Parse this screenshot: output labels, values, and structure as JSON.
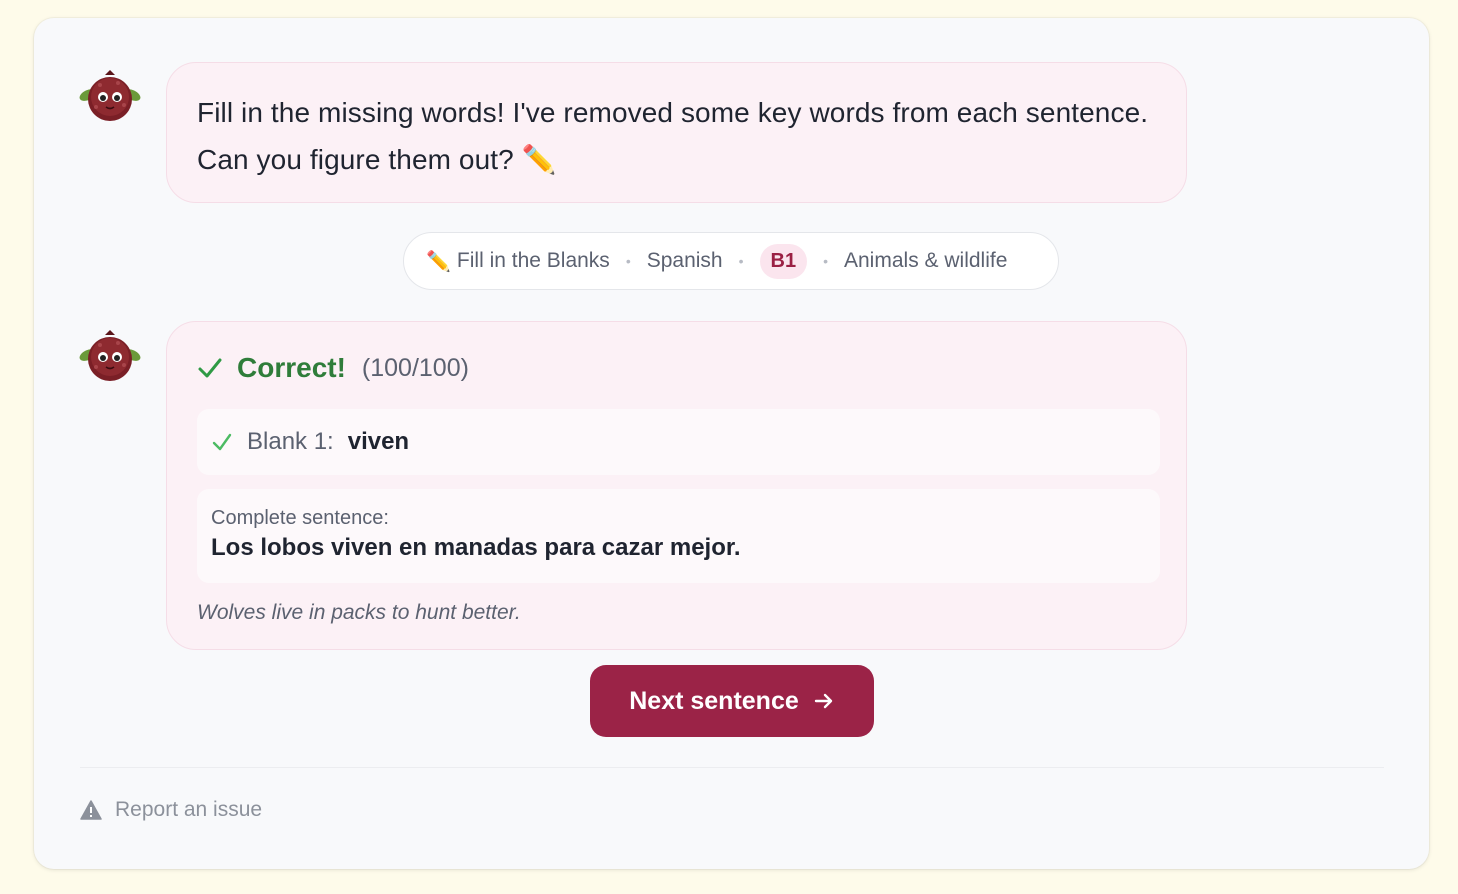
{
  "intro_message": {
    "text": "Fill in the missing words! I've removed some key words from each sentence. Can you figure them out? ✏️"
  },
  "exercise_info": {
    "mode_icon": "pencil-icon",
    "mode": "Fill in the Blanks",
    "language": "Spanish",
    "level": "B1",
    "topic": "Animals & wildlife"
  },
  "result": {
    "status": "Correct!",
    "score": "(100/100)",
    "blanks": [
      {
        "label": "Blank 1:",
        "answer": "viven"
      }
    ],
    "complete_sentence_label": "Complete sentence:",
    "complete_sentence": "Los lobos viven en manadas para cazar mejor.",
    "translation": "Wolves live in packs to hunt better."
  },
  "actions": {
    "next_label": "Next sentence"
  },
  "footer": {
    "report_label": "Report an issue"
  },
  "colors": {
    "accent": "#9b2347",
    "success": "#2f7d3a",
    "bubble": "#fcf1f6",
    "page_background": "#fefbea"
  }
}
